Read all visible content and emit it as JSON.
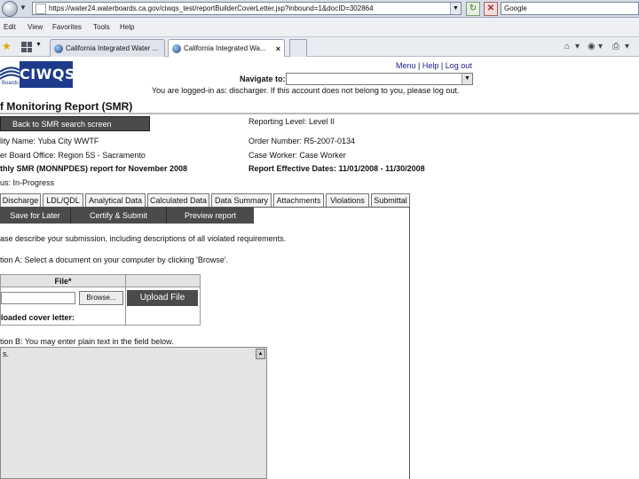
{
  "browser": {
    "url": "https://water24.waterboards.ca.gov/ciwqs_test/reportBuilderCoverLetter.jsp?inbound=1&docID=302864",
    "search": "Google",
    "menu": [
      "Edit",
      "View",
      "Favorites",
      "Tools",
      "Help"
    ],
    "tabs": [
      {
        "label": "California Integrated Water ..."
      },
      {
        "label": "California Integrated Wa...",
        "close": "×"
      }
    ]
  },
  "header": {
    "logo_text": "CIWQS",
    "logo_sub": "Boards",
    "links": [
      "Menu",
      "Help",
      "Log out"
    ],
    "navigate_label": "Navigate to:",
    "login_notice": "You are logged-in as: discharger. If this account does not belong to you, please log out."
  },
  "page": {
    "title": "f Monitoring Report (SMR)",
    "back_button": "Back to SMR search screen"
  },
  "info": {
    "facility": "lity Name: Yuba City WWTF",
    "board_office": "er Board Office: Region 5S - Sacramento",
    "report": "thly SMR (MONNPDES) report for November 2008",
    "status": "us: In-Progress",
    "reporting_level": "Reporting Level: Level II",
    "order_number": "Order Number: R5-2007-0134",
    "case_worker": "Case Worker: Case Worker",
    "effective_dates_label": "Report Effective Dates:",
    "effective_dates_value": "11/01/2008 - 11/30/2008"
  },
  "tabs": [
    {
      "label": "Discharge"
    },
    {
      "label": "LDL/QDL"
    },
    {
      "label": "Analytical Data"
    },
    {
      "label": "Calculated Data"
    },
    {
      "label": "Data Summary"
    },
    {
      "label": "Attachments"
    },
    {
      "label": "Violations"
    },
    {
      "label": "Submittal"
    }
  ],
  "actions": {
    "save_later": "Save for Later",
    "certify": "Certify & Submit",
    "preview": "Preview report"
  },
  "cover": {
    "describe": "ase describe your submission, including descriptions of all violated requirements.",
    "option_a": "tion A: Select a document on your computer by clicking 'Browse'.",
    "file_header": "File*",
    "browse": "Browse...",
    "upload": "Upload File",
    "uploaded_label": "loaded cover letter:",
    "option_b": "tion B: You may enter plain text in the field below.",
    "textarea_text": "s."
  }
}
